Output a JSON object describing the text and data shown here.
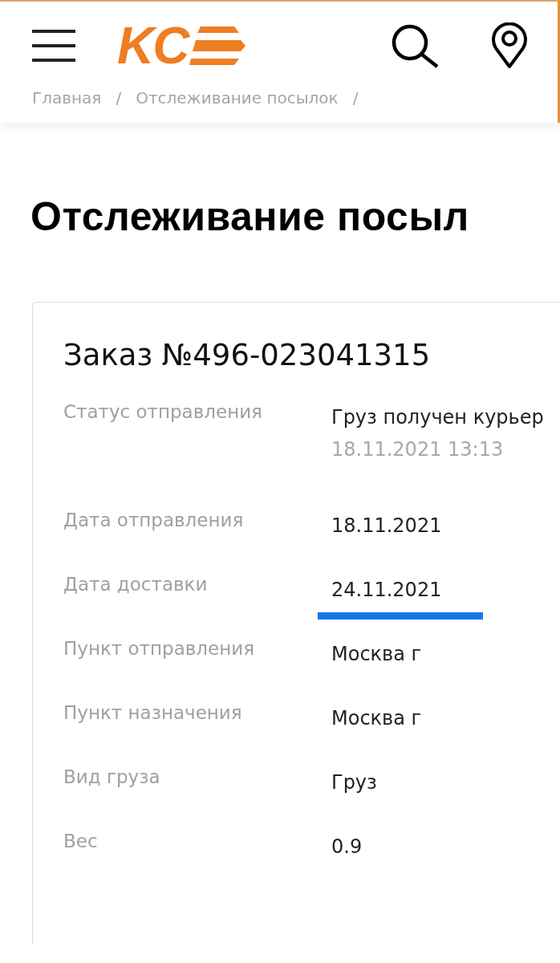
{
  "header": {
    "logo_text": "KC"
  },
  "breadcrumbs": [
    {
      "label": "Главная",
      "separator": "/"
    },
    {
      "label": "Отслеживание посылок",
      "separator": "/"
    }
  ],
  "page_title": "Отслеживание посыл",
  "order": {
    "title": "Заказ №496-023041315",
    "rows": [
      {
        "label": "Статус отправления",
        "value": "Груз получен курьер",
        "note": "18.11.2021 13:13",
        "underlined": false
      },
      {
        "label": "Дата отправления",
        "value": "18.11.2021",
        "underlined": false
      },
      {
        "label": "Дата доставки",
        "value": "24.11.2021",
        "underlined": true
      },
      {
        "label": "Пункт отправления",
        "value": "Москва г",
        "underlined": false
      },
      {
        "label": "Пункт назначения",
        "value": "Москва г",
        "underlined": false
      },
      {
        "label": "Вид груза",
        "value": "Груз",
        "underlined": false
      },
      {
        "label": "Вес",
        "value": "0.9",
        "underlined": false
      }
    ]
  }
}
